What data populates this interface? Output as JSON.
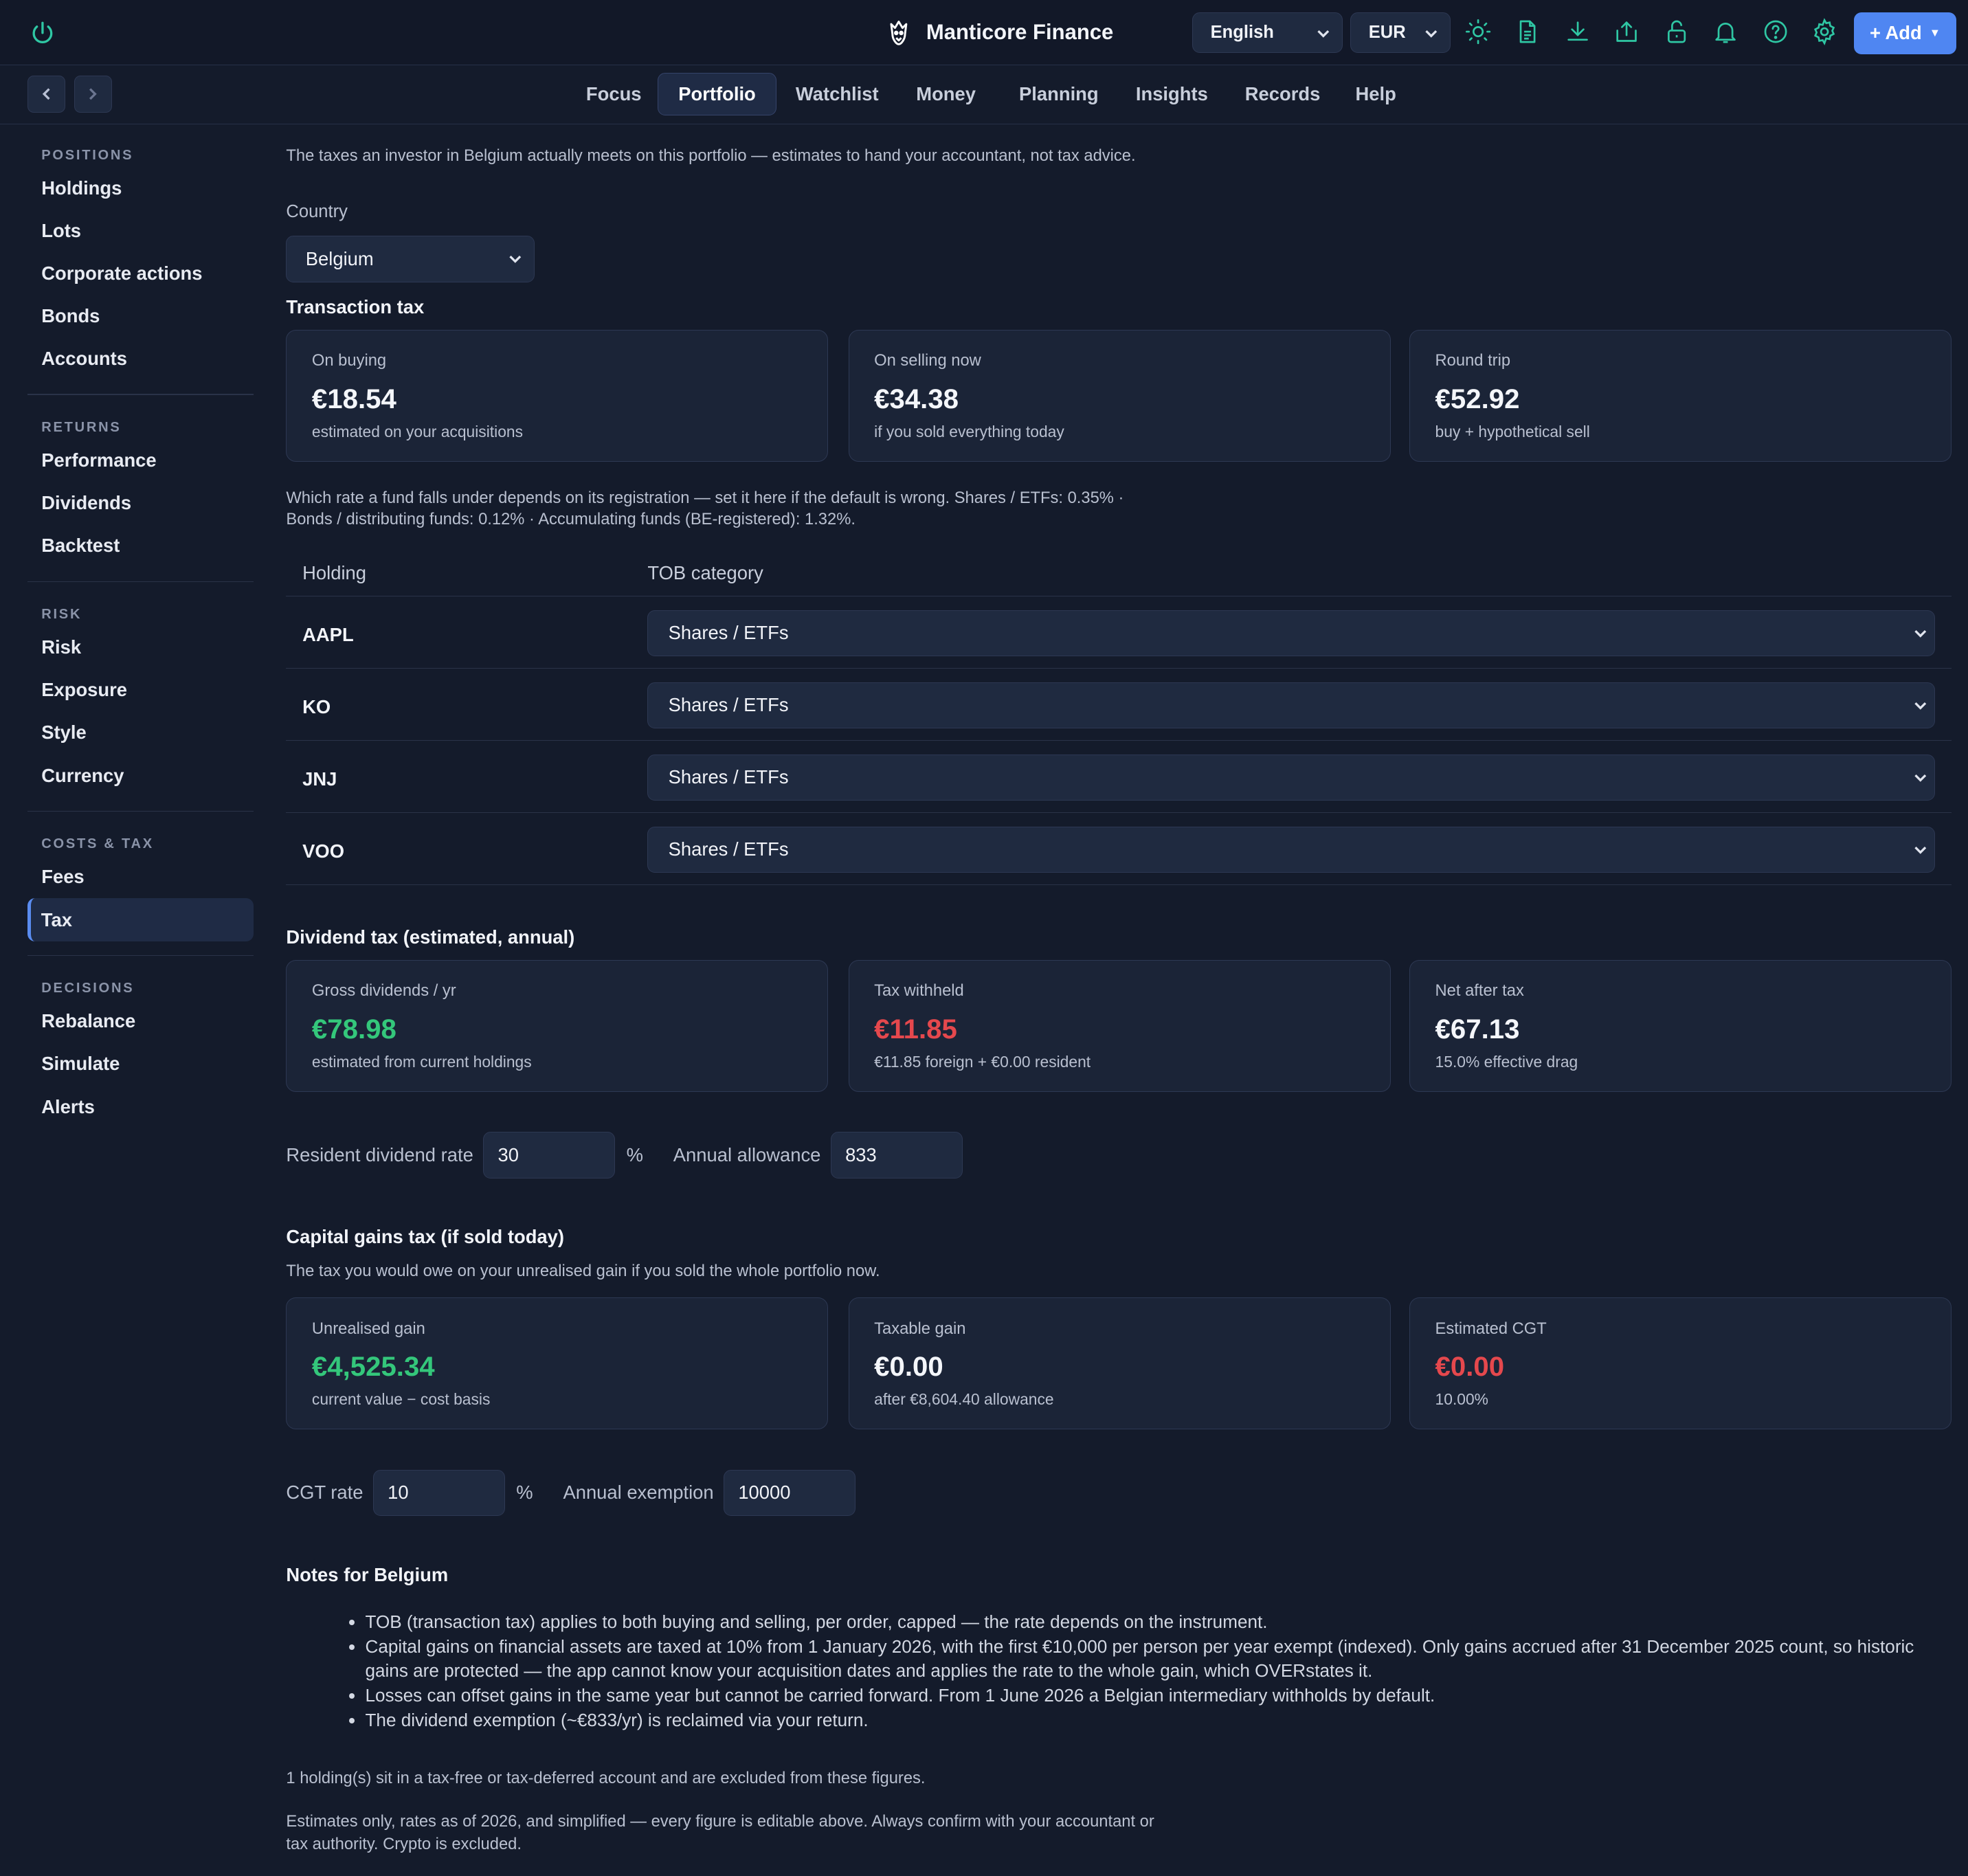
{
  "app": {
    "title": "Manticore Finance"
  },
  "header": {
    "language": "English",
    "currency": "EUR",
    "add_label": "+ Add",
    "icons": [
      "power-icon",
      "sun-icon",
      "document-icon",
      "download-icon",
      "upload-icon",
      "unlock-icon",
      "bell-icon",
      "help-icon",
      "gear-icon"
    ]
  },
  "nav": {
    "tabs": [
      {
        "label": "Focus"
      },
      {
        "label": "Portfolio",
        "active": true
      },
      {
        "label": "Watchlist"
      },
      {
        "label": "Money"
      },
      {
        "label": "Planning"
      },
      {
        "label": "Insights"
      },
      {
        "label": "Records"
      },
      {
        "label": "Help"
      }
    ]
  },
  "sidebar": {
    "groups": [
      {
        "title": "POSITIONS",
        "items": [
          "Holdings",
          "Lots",
          "Corporate actions",
          "Bonds",
          "Accounts"
        ]
      },
      {
        "title": "RETURNS",
        "items": [
          "Performance",
          "Dividends",
          "Backtest"
        ]
      },
      {
        "title": "RISK",
        "items": [
          "Risk",
          "Exposure",
          "Style",
          "Currency"
        ]
      },
      {
        "title": "COSTS & TAX",
        "items": [
          "Fees",
          "Tax"
        ]
      },
      {
        "title": "DECISIONS",
        "items": [
          "Rebalance",
          "Simulate",
          "Alerts"
        ]
      }
    ],
    "active": "Tax"
  },
  "main": {
    "intro": "The taxes an investor in Belgium actually meets on this portfolio — estimates to hand your accountant, not tax advice.",
    "country_label": "Country",
    "country_value": "Belgium",
    "transaction_tax": {
      "title": "Transaction tax",
      "cards": [
        {
          "label": "On buying",
          "value": "€18.54",
          "sub": "estimated on your acquisitions"
        },
        {
          "label": "On selling now",
          "value": "€34.38",
          "sub": "if you sold everything today"
        },
        {
          "label": "Round trip",
          "value": "€52.92",
          "sub": "buy + hypothetical sell"
        }
      ],
      "note_line1": "Which rate a fund falls under depends on its registration — set it here if the default is wrong. Shares / ETFs: 0.35% ·",
      "note_line2": "Bonds / distributing funds: 0.12% · Accumulating funds (BE-registered): 1.32%.",
      "table": {
        "col_holding": "Holding",
        "col_category": "TOB category",
        "rows": [
          {
            "symbol": "AAPL",
            "category": "Shares / ETFs"
          },
          {
            "symbol": "KO",
            "category": "Shares / ETFs"
          },
          {
            "symbol": "JNJ",
            "category": "Shares / ETFs"
          },
          {
            "symbol": "VOO",
            "category": "Shares / ETFs"
          }
        ]
      }
    },
    "dividend_tax": {
      "title": "Dividend tax (estimated, annual)",
      "cards": [
        {
          "label": "Gross dividends / yr",
          "value": "€78.98",
          "sub": "estimated from current holdings"
        },
        {
          "label": "Tax withheld",
          "value": "€11.85",
          "sub": "€11.85 foreign + €0.00 resident"
        },
        {
          "label": "Net after tax",
          "value": "€67.13",
          "sub": "15.0% effective drag"
        }
      ],
      "rate_label": "Resident dividend rate",
      "rate_value": "30",
      "rate_unit": "%",
      "allowance_label": "Annual allowance",
      "allowance_value": "833"
    },
    "cgt": {
      "title": "Capital gains tax (if sold today)",
      "subtitle": "The tax you would owe on your unrealised gain if you sold the whole portfolio now.",
      "cards": [
        {
          "label": "Unrealised gain",
          "value": "€4,525.34",
          "sub": "current value − cost basis"
        },
        {
          "label": "Taxable gain",
          "value": "€0.00",
          "sub": "after €8,604.40 allowance"
        },
        {
          "label": "Estimated CGT",
          "value": "€0.00",
          "sub": "10.00%"
        }
      ],
      "rate_label": "CGT rate",
      "rate_value": "10",
      "rate_unit": "%",
      "exemption_label": "Annual exemption",
      "exemption_value": "10000"
    },
    "notes": {
      "title": "Notes for Belgium",
      "items": [
        "TOB (transaction tax) applies to both buying and selling, per order, capped — the rate depends on the instrument.",
        "Capital gains on financial assets are taxed at 10% from 1 January 2026, with the first €10,000 per person per year exempt (indexed). Only gains accrued after 31 December 2025 count, so historic gains are protected — the app cannot know your acquisition dates and applies the rate to the whole gain, which OVERstates it.",
        "Losses can offset gains in the same year but cannot be carried forward. From 1 June 2026 a Belgian intermediary withholds by default.",
        "The dividend exemption (~€833/yr) is reclaimed via your return."
      ]
    },
    "footer_excluded": "1 holding(s) sit in a tax-free or tax-deferred account and are excluded from these figures.",
    "footer_disclaimer_line1": "Estimates only, rates as of 2026, and simplified — every figure is editable above. Always confirm with your accountant or",
    "footer_disclaimer_line2": "tax authority. Crypto is excluded.",
    "colors": {
      "positive": "#34c77b",
      "negative": "#e5484d",
      "accent": "#2fc7a4",
      "primary": "#4f86f2"
    }
  }
}
